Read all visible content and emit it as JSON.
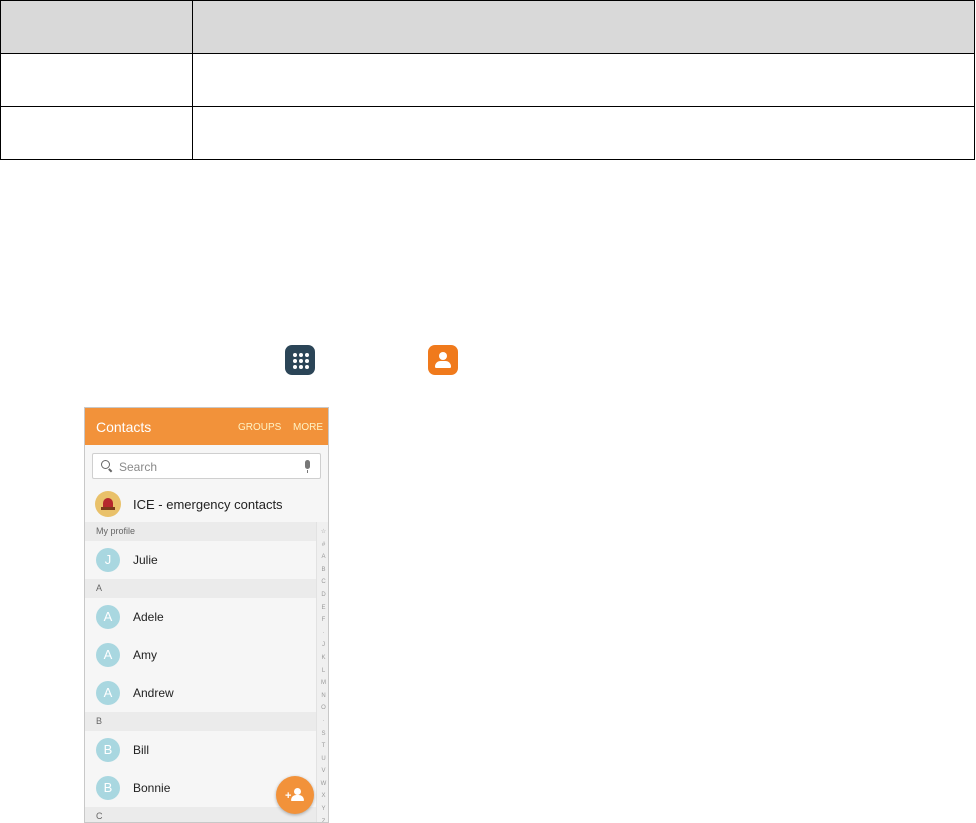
{
  "table": {
    "rows": [
      [
        "",
        ""
      ],
      [
        "",
        ""
      ],
      [
        "",
        ""
      ]
    ]
  },
  "phone": {
    "appbar": {
      "title": "Contacts",
      "groups": "GROUPS",
      "more": "MORE",
      "color": "#f2923a"
    },
    "search": {
      "placeholder": "Search"
    },
    "ice": {
      "label": "ICE - emergency contacts"
    },
    "sections": [
      {
        "header": "My profile",
        "contacts": [
          {
            "initial": "J",
            "name": "Julie"
          }
        ]
      },
      {
        "header": "A",
        "contacts": [
          {
            "initial": "A",
            "name": "Adele"
          },
          {
            "initial": "A",
            "name": "Amy"
          },
          {
            "initial": "A",
            "name": "Andrew"
          }
        ]
      },
      {
        "header": "B",
        "contacts": [
          {
            "initial": "B",
            "name": "Bill"
          },
          {
            "initial": "B",
            "name": "Bonnie"
          }
        ]
      },
      {
        "header": "C",
        "contacts": []
      }
    ],
    "index_letters": [
      "☆",
      "#",
      "A",
      "B",
      "C",
      "D",
      "E",
      "F",
      "·",
      "J",
      "K",
      "L",
      "M",
      "N",
      "O",
      "·",
      "S",
      "T",
      "U",
      "V",
      "W",
      "X",
      "Y",
      "Z"
    ]
  },
  "icons": {
    "apps": "apps-grid-icon",
    "contacts": "contacts-app-icon",
    "fab": "add-contact-icon"
  }
}
